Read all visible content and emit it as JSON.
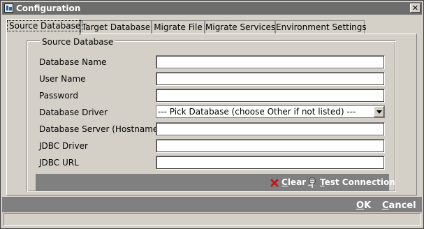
{
  "window": {
    "title": "Configuration",
    "close_glyph": "✕"
  },
  "tabs": [
    {
      "label": "Source Database",
      "active": true
    },
    {
      "label": "Target Database",
      "active": false
    },
    {
      "label": "Migrate File",
      "active": false
    },
    {
      "label": "Migrate Services",
      "active": false
    },
    {
      "label": "Environment Settings",
      "active": false
    }
  ],
  "group": {
    "label": "Source Database"
  },
  "fields": {
    "database_name": {
      "label": "Database Name",
      "value": ""
    },
    "user_name": {
      "label": "User Name",
      "value": ""
    },
    "password": {
      "label": "Password",
      "value": ""
    },
    "database_driver": {
      "label": "Database Driver",
      "selected": "--- Pick Database (choose Other if not listed) ---"
    },
    "database_server": {
      "label": "Database Server (Hostname)",
      "value": ""
    },
    "jdbc_driver": {
      "label": "JDBC Driver",
      "value": ""
    },
    "jdbc_url": {
      "label": "JDBC URL",
      "value": ""
    }
  },
  "actions": {
    "clear": {
      "mnemonic": "C",
      "rest": "lear",
      "icon": "red-x-icon"
    },
    "test_connection": {
      "mnemonic": "T",
      "rest": "est Connection",
      "icon": "plug-icon"
    }
  },
  "dialog_buttons": {
    "ok": {
      "mnemonic": "O",
      "rest": "K"
    },
    "cancel": {
      "mnemonic": "C",
      "rest": "ancel"
    }
  },
  "colors": {
    "titlebar": "#6d6d6d",
    "button_bar": "#808080",
    "clear_icon": "#c01818"
  }
}
